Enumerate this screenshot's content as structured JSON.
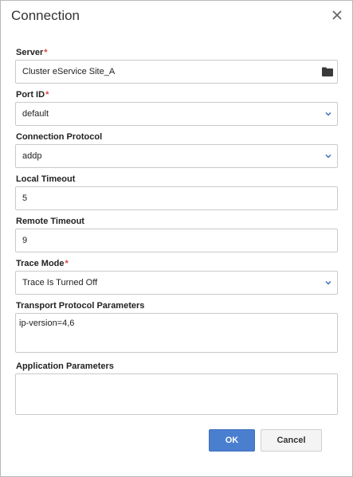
{
  "dialog": {
    "title": "Connection",
    "close_icon": "close-icon"
  },
  "fields": {
    "server": {
      "label": "Server",
      "required_mark": "*",
      "value": "Cluster eService Site_A",
      "icon": "folder-icon"
    },
    "port_id": {
      "label": "Port ID",
      "required_mark": "*",
      "value": "default",
      "icon": "chevron-down-icon"
    },
    "connection_protocol": {
      "label": "Connection Protocol",
      "value": "addp",
      "icon": "chevron-down-icon"
    },
    "local_timeout": {
      "label": "Local Timeout",
      "value": "5"
    },
    "remote_timeout": {
      "label": "Remote Timeout",
      "value": "9"
    },
    "trace_mode": {
      "label": "Trace Mode",
      "required_mark": "*",
      "value": "Trace Is Turned Off",
      "icon": "chevron-down-icon"
    },
    "transport_protocol_parameters": {
      "label": "Transport Protocol Parameters",
      "value": "ip-version=4,6"
    },
    "application_parameters": {
      "label": "Application Parameters",
      "value": ""
    }
  },
  "buttons": {
    "ok": "OK",
    "cancel": "Cancel"
  },
  "colors": {
    "accent": "#4a7ecf",
    "required": "#e0433b",
    "icon": "#3d6fb8"
  }
}
